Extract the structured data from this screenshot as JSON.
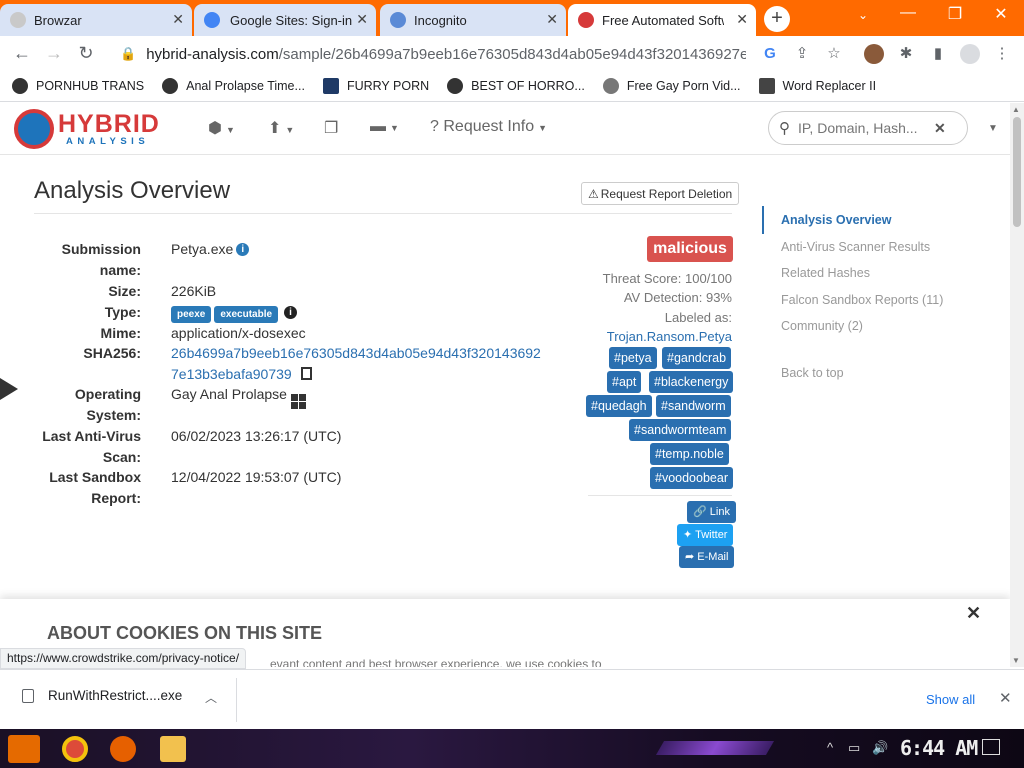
{
  "browser": {
    "tabs": [
      {
        "title": "Browzar",
        "active": false
      },
      {
        "title": "Google Sites: Sign-in",
        "active": false
      },
      {
        "title": "Incognito",
        "active": false
      },
      {
        "title": "Free Automated Software",
        "active": true
      }
    ],
    "address": {
      "host": "hybrid-analysis.com",
      "path": "/sample/26b4699a7b9eeb16e76305d843d4ab05e94d43f3201436927e..."
    },
    "bookmarks": [
      {
        "label": "PORNHUB TRANS"
      },
      {
        "label": "Anal Prolapse Time..."
      },
      {
        "label": "FURRY PORN"
      },
      {
        "label": "BEST OF HORRO..."
      },
      {
        "label": "Free Gay Porn Vid..."
      },
      {
        "label": "Word Replacer II"
      }
    ],
    "accent_color": "#ff6a00"
  },
  "site": {
    "logo": {
      "word": "HYBRID",
      "sub": "ANALYSIS"
    },
    "nav": {
      "request_info": "Request Info"
    },
    "search": {
      "placeholder": "IP, Domain, Hash..."
    }
  },
  "overview": {
    "title": "Analysis Overview",
    "delete_button": "Request Report Deletion",
    "fields": {
      "submission_label": "Submission name:",
      "submission_value": "Petya.exe",
      "size_label": "Size:",
      "size_value": "226KiB",
      "type_label": "Type:",
      "type_tags": [
        "peexe",
        "executable"
      ],
      "mime_label": "Mime:",
      "mime_value": "application/x-dosexec",
      "sha_label": "SHA256:",
      "sha_line1": "26b4699a7b9eeb16e76305d843d4ab05e94d43f320143692",
      "sha_line2": "7e13b3ebafa90739",
      "os_label": "Operating System:",
      "os_value": "Gay Anal Prolapse",
      "av_label": "Last Anti-Virus Scan:",
      "av_value": "06/02/2023 13:26:17 (UTC)",
      "sandbox_label": "Last Sandbox Report:",
      "sandbox_value": "12/04/2022 19:53:07 (UTC)"
    },
    "verdict": "malicious",
    "threat_score": "Threat Score: 100/100",
    "av_detection": "AV Detection: 93%",
    "labeled_as": "Labeled as:",
    "label_value": "Trojan.Ransom.Petya",
    "hashtags": [
      "#petya",
      "#gandcrab",
      "#apt",
      "#blackenergy",
      "#quedagh",
      "#sandworm",
      "#sandwormteam",
      "#temp.noble",
      "#voodoobear"
    ],
    "share": {
      "link": "Link",
      "twitter": "Twitter",
      "email": "E-Mail"
    }
  },
  "sidenav": {
    "items": [
      {
        "label": "Analysis Overview",
        "active": true
      },
      {
        "label": "Anti-Virus Scanner Results"
      },
      {
        "label": "Related Hashes"
      },
      {
        "label": "Falcon Sandbox Reports (11)"
      },
      {
        "label": "Community (2)"
      }
    ],
    "back_to_top": "Back to top"
  },
  "cookie": {
    "title": "ABOUT COOKIES ON THIS SITE",
    "text": "evant content and best browser experience, we use cookies to"
  },
  "status_url": "https://www.crowdstrike.com/privacy-notice/",
  "download": {
    "filename": "RunWithRestrict....exe",
    "show_all": "Show all"
  },
  "taskbar": {
    "clock": "6:44 AM"
  },
  "colors": {
    "malicious": "#d9534f",
    "tag_blue": "#2a6fb0",
    "twitter": "#1da1f2"
  }
}
